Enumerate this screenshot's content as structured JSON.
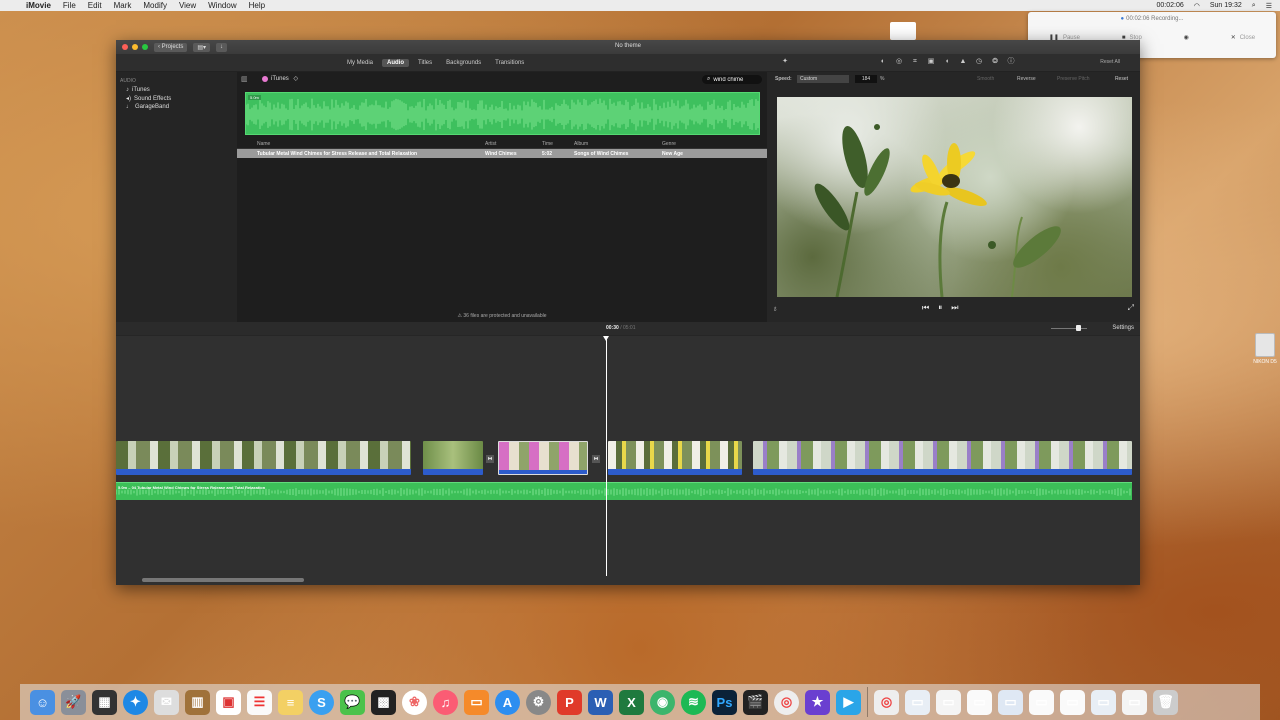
{
  "menubar": {
    "app": "iMovie",
    "items": [
      "File",
      "Edit",
      "Mark",
      "Modify",
      "View",
      "Window",
      "Help"
    ],
    "clock": "Sun 19:32",
    "rec_time": "00:02:06"
  },
  "recording_panel": {
    "title": "00:02:06 Recording...",
    "pause": "Pause",
    "stop": "Stop",
    "close": "Close"
  },
  "window": {
    "title": "No theme",
    "projects_button": "Projects",
    "tabs": [
      "My Media",
      "Audio",
      "Titles",
      "Backgrounds",
      "Transitions"
    ],
    "active_tab": "Audio",
    "reset_all": "Reset All"
  },
  "sidebar": {
    "header": "AUDIO",
    "items": [
      {
        "label": "iTunes",
        "icon": "music-note-icon"
      },
      {
        "label": "Sound Effects",
        "icon": "speaker-icon"
      },
      {
        "label": "GarageBand",
        "icon": "guitar-icon"
      }
    ]
  },
  "browser": {
    "source": "iTunes",
    "search_value": "wind chime",
    "waveform_label": "5.0m",
    "columns": [
      "Name",
      "Artist",
      "Time",
      "Album",
      "Genre"
    ],
    "rows": [
      [
        "Tubular Metal Wind Chimes for Stress Release and Total Relaxation",
        "Wind Chimes",
        "5:02",
        "Songs of Wind Chimes",
        "New Age"
      ]
    ],
    "footer": "36 files are protected and unavailable"
  },
  "viewer": {
    "speed_label": "Speed:",
    "speed_value": "Custom",
    "speed_percent": "184",
    "percent_sign": "%",
    "smooth": "Smooth",
    "reverse": "Reverse",
    "preserve_pitch": "Preserve Pitch",
    "reset": "Reset"
  },
  "timeline": {
    "current_time": "00:30",
    "total_time": "05:01",
    "settings": "Settings",
    "music_label": "5.0m – 04 Tubular Metal Wind Chimes for Stress Release and Total Relaxation"
  },
  "desktop_icon": {
    "label": "NIKON D5"
  },
  "colors": {
    "waveform_green": "#3ec05e",
    "clip_audio_blue": "#2d5ccc",
    "playhead": "#ffffff"
  }
}
